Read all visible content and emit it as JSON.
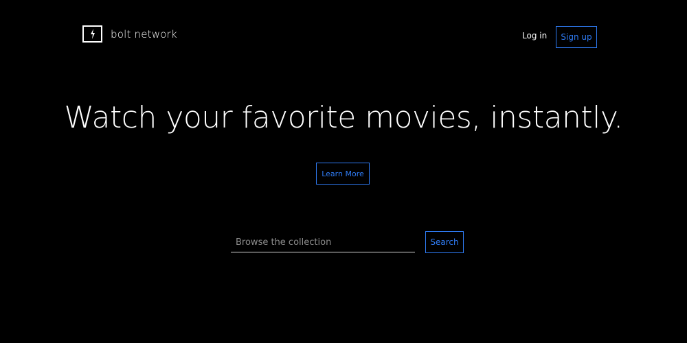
{
  "header": {
    "brand": "bolt network",
    "brand_icon": "lightning-bolt-icon",
    "login_label": "Log in",
    "signup_label": "Sign up"
  },
  "hero": {
    "headline": "Watch your favorite movies, instantly.",
    "learn_more_label": "Learn More"
  },
  "search": {
    "placeholder": "Browse the collection",
    "button_label": "Search"
  },
  "colors": {
    "background": "#000000",
    "accent": "#2f7cf5",
    "text": "#ffffff"
  }
}
